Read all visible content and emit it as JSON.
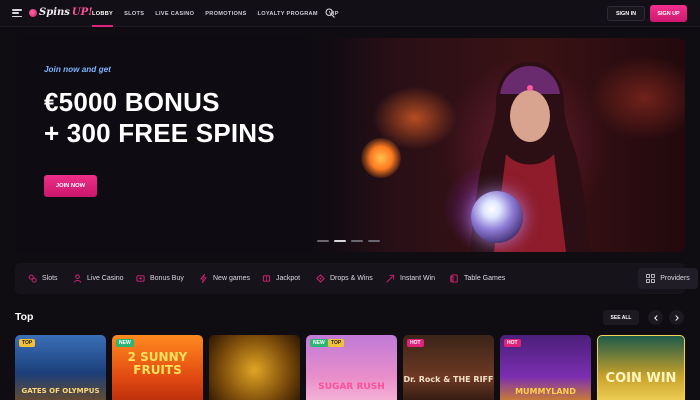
{
  "header": {
    "logo_text": "Spins",
    "logo_accent": "UP!",
    "nav": [
      "LOBBY",
      "SLOTS",
      "LIVE CASINO",
      "PROMOTIONS",
      "LOYALTY PROGRAM",
      "VIP"
    ],
    "signin_label": "SIGN IN",
    "signup_label": "SIGN UP"
  },
  "hero": {
    "kicker": "Join now and get",
    "title_line1": "€5000 BONUS",
    "title_line2": "+ 300 FREE SPINS",
    "cta_label": "JOIN NOW",
    "slides_count": 4,
    "active_slide": 2
  },
  "categories": [
    {
      "label": "Slots",
      "icon": "slots-icon"
    },
    {
      "label": "Live Casino",
      "icon": "dealer-icon"
    },
    {
      "label": "Bonus Buy",
      "icon": "bonus-buy-icon"
    },
    {
      "label": "New games",
      "icon": "lightning-icon"
    },
    {
      "label": "Jackpot",
      "icon": "jackpot-icon"
    },
    {
      "label": "Drops & Wins",
      "icon": "drops-icon"
    },
    {
      "label": "Instant Win",
      "icon": "instant-win-icon"
    },
    {
      "label": "Table Games",
      "icon": "table-games-icon"
    }
  ],
  "providers_label": "Providers",
  "top": {
    "title": "Top",
    "see_all": "SEE ALL",
    "games": [
      {
        "title": "GATES OF OLYMPUS",
        "badges": [
          "TOP"
        ]
      },
      {
        "title": "2 SUNNY FRUITS",
        "badges": [
          "NEW"
        ]
      },
      {
        "title": "",
        "badges": []
      },
      {
        "title": "SUGAR RUSH",
        "badges": [
          "NEW",
          "TOP"
        ]
      },
      {
        "title": "Dr. Rock & THE RIFF",
        "badges": [
          "HOT"
        ]
      },
      {
        "title": "MUMMYLAND",
        "badges": [
          "HOT"
        ]
      },
      {
        "title": "COIN WIN",
        "badges": []
      }
    ]
  },
  "colors": {
    "accent": "#e0237a",
    "background": "#0f0d12",
    "kicker": "#7fb4ff"
  }
}
